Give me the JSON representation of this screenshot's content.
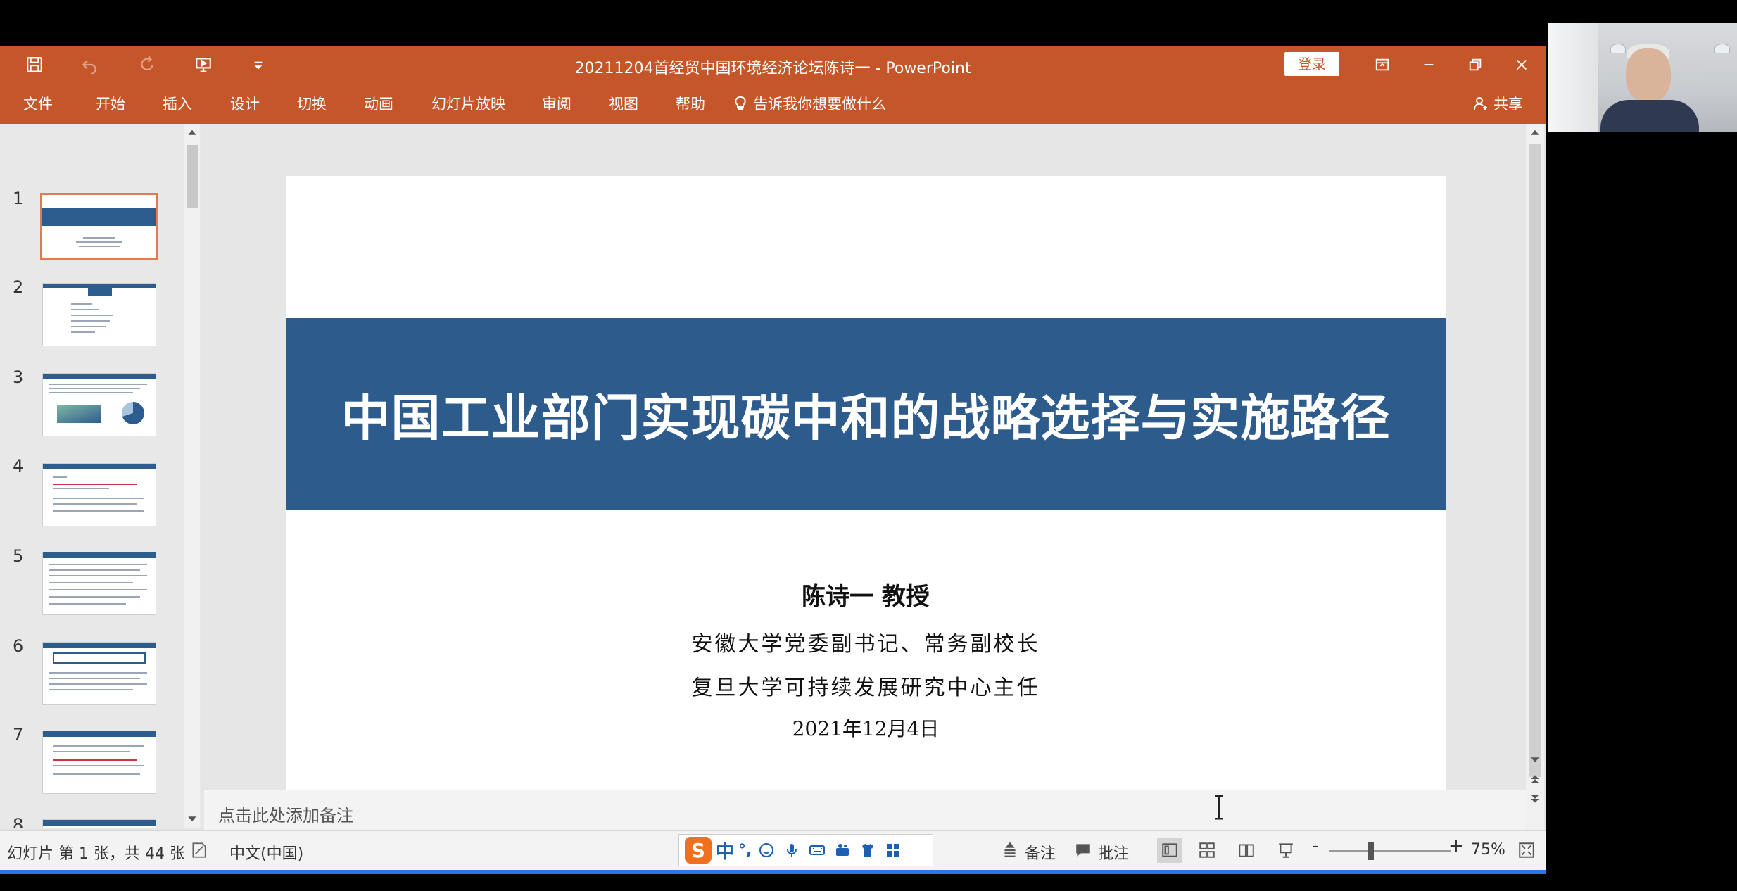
{
  "titlebar": {
    "doc_title": "20211204首经贸中国环境经济论坛陈诗一  -  PowerPoint",
    "login_label": "登录"
  },
  "ribbon": {
    "tabs": [
      "文件",
      "开始",
      "插入",
      "设计",
      "切换",
      "动画",
      "幻灯片放映",
      "审阅",
      "视图",
      "帮助"
    ],
    "tell_me": "告诉我你想要做什么",
    "share": "共享"
  },
  "thumbnails": {
    "numbers": [
      "1",
      "2",
      "3",
      "4",
      "5",
      "6",
      "7",
      "8"
    ],
    "selected_index": 1
  },
  "slide": {
    "title": "中国工业部门实现碳中和的战略选择与实施路径",
    "author": "陈诗一  教授",
    "affiliation_1": "安徽大学党委副书记、常务副校长",
    "affiliation_2": "复旦大学可持续发展研究中心主任",
    "date": "2021年12月4日",
    "accent_color": "#2d5b8c"
  },
  "notes": {
    "placeholder": "点击此处添加备注"
  },
  "statusbar": {
    "slide_info": "幻灯片 第 1 张，共 44 张",
    "language": "中文(中国)",
    "ime_mode": "中",
    "ime_punct": "°,",
    "notes_label": "备注",
    "comments_label": "批注",
    "zoom_minus": "-",
    "zoom_plus": "+",
    "zoom": "75%"
  },
  "colors": {
    "ribbon": "#c5562a",
    "progress_line": "#2b78e4"
  }
}
